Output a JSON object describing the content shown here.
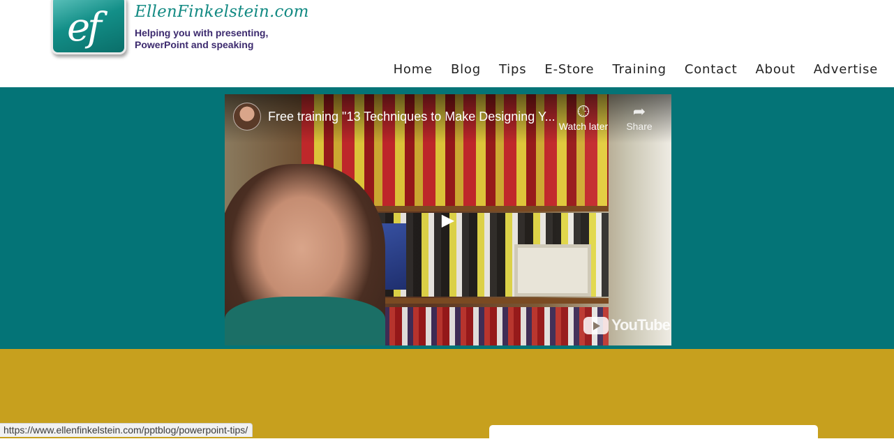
{
  "header": {
    "logo_text": "ef",
    "site_name": "EllenFinkelstein.com",
    "tagline": "Helping you with presenting, PowerPoint and speaking"
  },
  "nav": {
    "items": [
      "Home",
      "Blog",
      "Tips",
      "E-Store",
      "Training",
      "Contact",
      "About",
      "Advertise"
    ]
  },
  "video": {
    "title": "Free training \"13 Techniques to Make Designing Y...",
    "watch_later_label": "Watch later",
    "share_label": "Share",
    "brand": "YouTube",
    "icons": {
      "watch_later": "clock-icon",
      "share": "share-arrow-icon",
      "play": "play-icon"
    }
  },
  "status_bar": {
    "url": "https://www.ellenfinkelstein.com/pptblog/powerpoint-tips/"
  },
  "colors": {
    "teal_band": "#047477",
    "gold_band": "#c7a01e",
    "site_name": "#138a83",
    "tagline": "#3c2a6e"
  }
}
